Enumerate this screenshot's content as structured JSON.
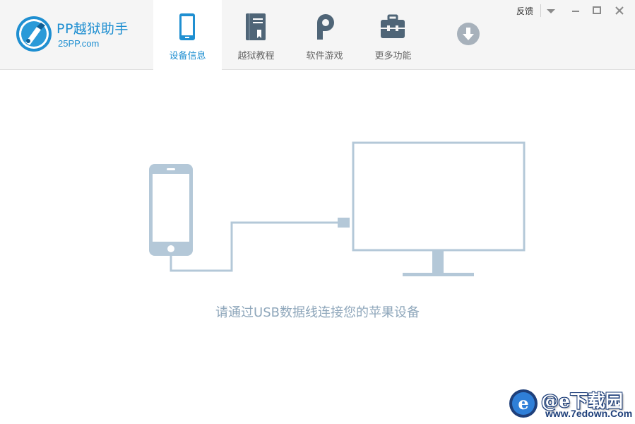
{
  "app": {
    "name": "PP越狱助手",
    "site": "25PP.com"
  },
  "tabs": [
    {
      "label": "设备信息",
      "icon": "phone-icon",
      "active": true
    },
    {
      "label": "越狱教程",
      "icon": "book-icon",
      "active": false
    },
    {
      "label": "软件游戏",
      "icon": "pp-logo-icon",
      "active": false
    },
    {
      "label": "更多功能",
      "icon": "toolbox-icon",
      "active": false
    }
  ],
  "window": {
    "feedback_label": "反馈"
  },
  "main": {
    "hint": "请通过USB数据线连接您的苹果设备"
  },
  "watermark": {
    "text": "@e下载园",
    "url": "www.7edown.Com"
  },
  "colors": {
    "accent": "#1f8fd1",
    "icon_gray": "#4f6577",
    "illustration": "#b4c8d8",
    "hint_text": "#8fa7bb"
  }
}
